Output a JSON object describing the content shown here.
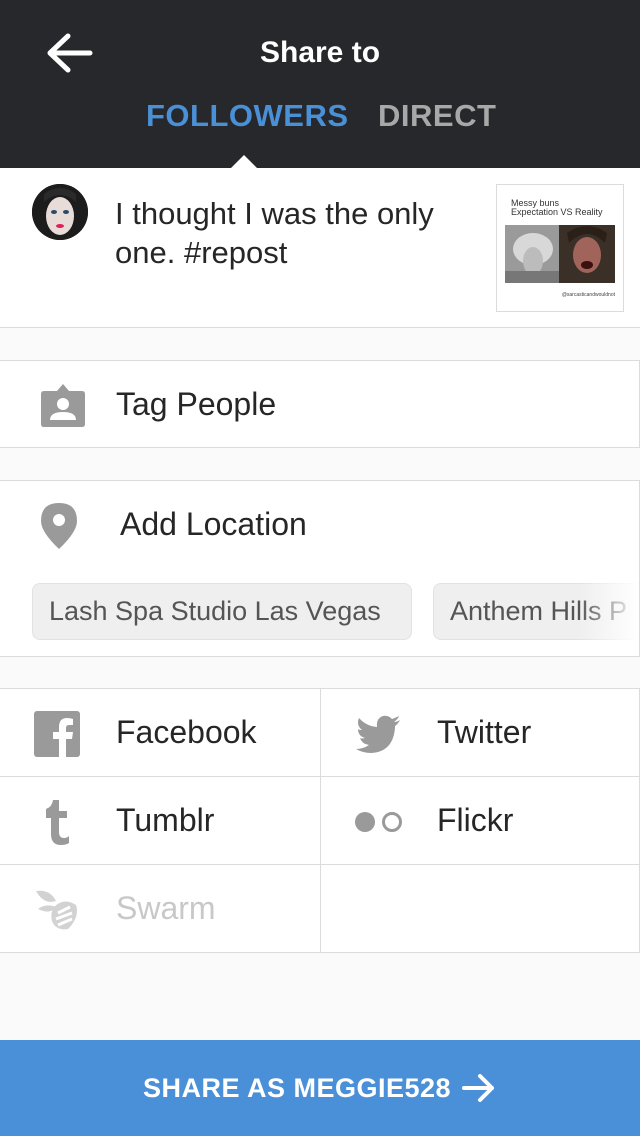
{
  "header": {
    "title": "Share to",
    "tabs": [
      {
        "label": "FOLLOWERS",
        "active": true
      },
      {
        "label": "DIRECT",
        "active": false
      }
    ]
  },
  "post": {
    "caption": "I thought I was the only one. #repost",
    "thumbnail": {
      "title": "Messy buns\nExpectation VS Reality",
      "credit": "@sarcasticandwouldnot"
    }
  },
  "tag_people": {
    "label": "Tag People",
    "icon": "tag-person-icon"
  },
  "location": {
    "label": "Add Location",
    "icon": "location-pin-icon",
    "suggestions": [
      "Lash Spa Studio Las Vegas",
      "Anthem Hills P"
    ]
  },
  "share_targets": [
    {
      "label": "Facebook",
      "icon": "facebook-icon",
      "enabled": true
    },
    {
      "label": "Twitter",
      "icon": "twitter-icon",
      "enabled": true
    },
    {
      "label": "Tumblr",
      "icon": "tumblr-icon",
      "enabled": true
    },
    {
      "label": "Flickr",
      "icon": "flickr-icon",
      "enabled": true
    },
    {
      "label": "Swarm",
      "icon": "swarm-icon",
      "enabled": false
    }
  ],
  "share_button": {
    "label": "SHARE AS MEGGIE528"
  },
  "colors": {
    "header_bg": "#27282c",
    "accent": "#4a90d6",
    "button_bg": "#4a90d9",
    "icon_gray": "#999999"
  }
}
